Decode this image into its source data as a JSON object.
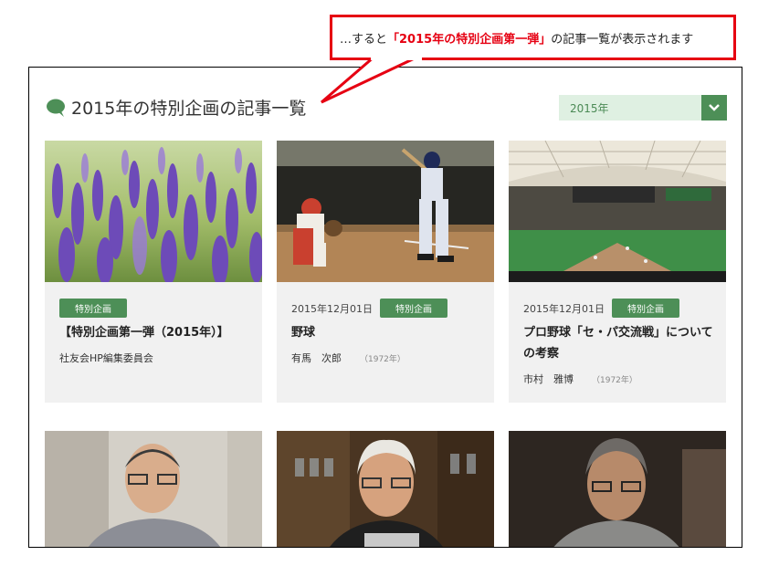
{
  "callout": {
    "prefix": "…すると",
    "highlight": "「2015年の特別企画第一弾」",
    "suffix": "の記事一覧が表示されます"
  },
  "header": {
    "title": "2015年の特別企画の記事一覧",
    "year_select_value": "2015年",
    "icon": "speech-bubble-icon",
    "accent_color": "#4d8f57"
  },
  "cards": [
    {
      "date": "",
      "badge": "特別企画",
      "title": "【特別企画第一弾（2015年）】",
      "author": "社友会HP編集委員会",
      "author_year": "",
      "image": "lavender-field-photo"
    },
    {
      "date": "2015年12月01日",
      "badge": "特別企画",
      "title": "野球",
      "author": "有馬　次郎",
      "author_year": "（1972年）",
      "image": "baseball-batter-photo"
    },
    {
      "date": "2015年12月01日",
      "badge": "特別企画",
      "title": "プロ野球「セ・パ交流戦」についての考察",
      "author": "市村　雅博",
      "author_year": "（1972年）",
      "image": "baseball-dome-photo"
    },
    {
      "image": "portrait-man-glasses-photo"
    },
    {
      "image": "portrait-man-white-hair-photo"
    },
    {
      "image": "portrait-man-dark-photo"
    }
  ]
}
